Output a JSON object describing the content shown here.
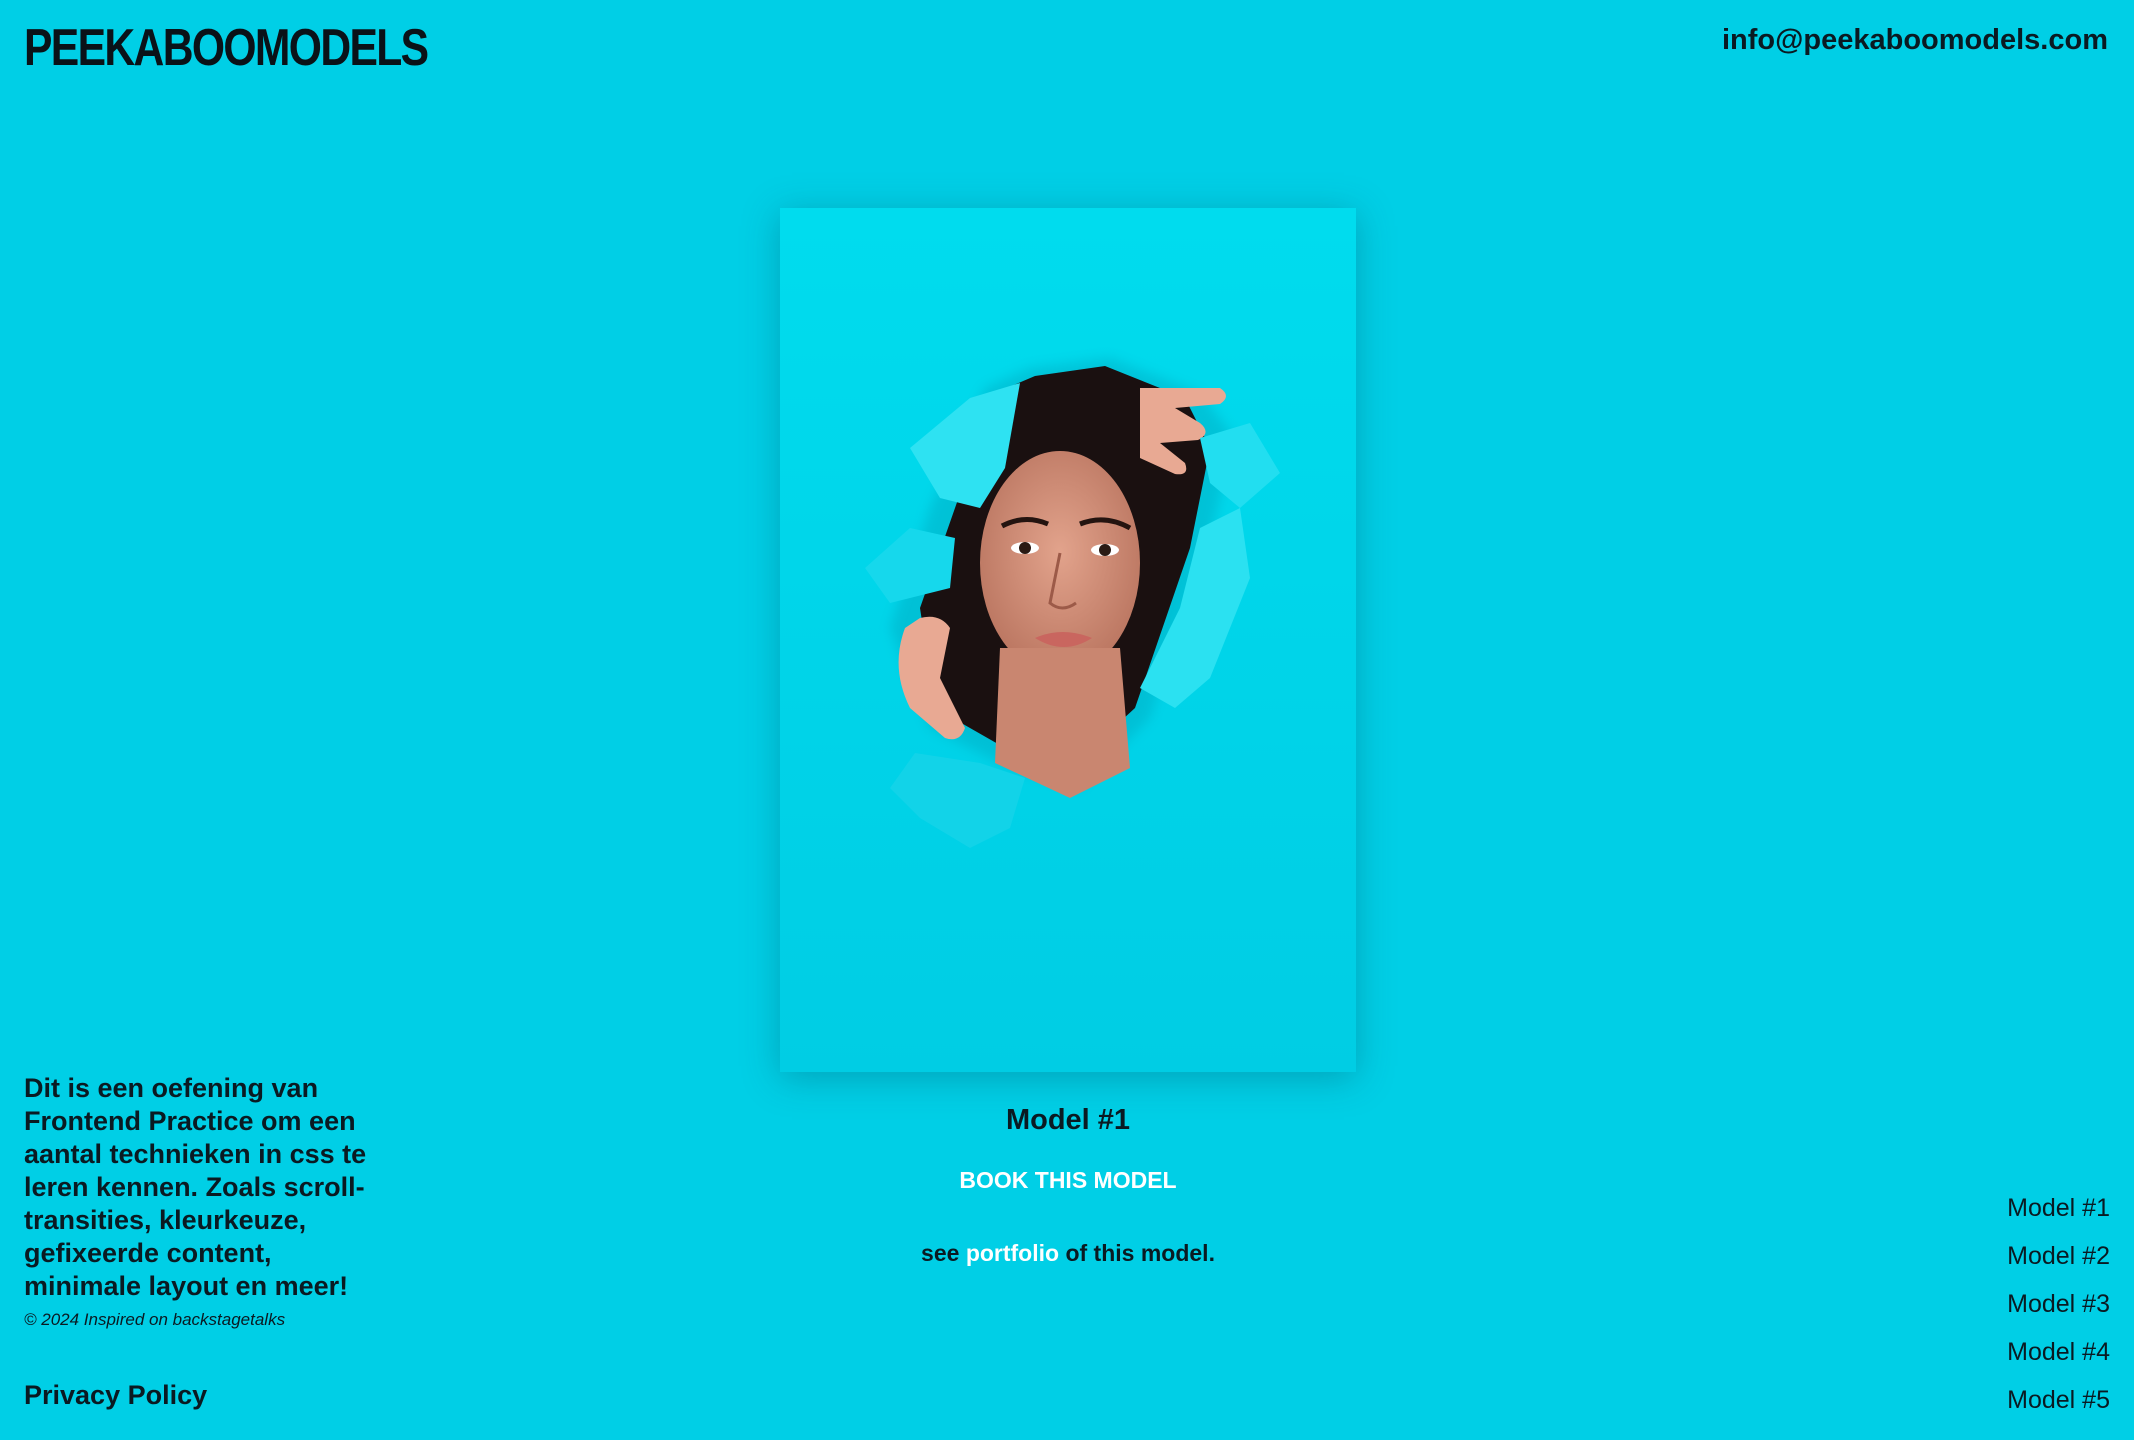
{
  "header": {
    "logo": "PEEKABOOMODELS",
    "email": "info@peekaboomodels.com"
  },
  "main": {
    "image_alt": "Model #1 peeking through torn turquoise paper",
    "model_title": "Model #1",
    "book_label": "BOOK THIS MODEL",
    "portfolio_prefix": "see",
    "portfolio_link": "portfolio",
    "portfolio_suffix": "of this model."
  },
  "footer": {
    "intro": "Dit is een oefening van Frontend Practice om een aantal technieken in css te leren kennen. Zoals scroll-transities, kleurkeuze, gefixeerde content, minimale layout en meer!",
    "copyright": "© 2024 Inspired on backstagetalks",
    "privacy": "Privacy Policy"
  },
  "model_nav": {
    "items": [
      {
        "label": "Model #1"
      },
      {
        "label": "Model #2"
      },
      {
        "label": "Model #3"
      },
      {
        "label": "Model #4"
      },
      {
        "label": "Model #5"
      }
    ]
  },
  "colors": {
    "background": "#00cfe6",
    "text": "#0a1a22",
    "link": "#ffffff"
  }
}
